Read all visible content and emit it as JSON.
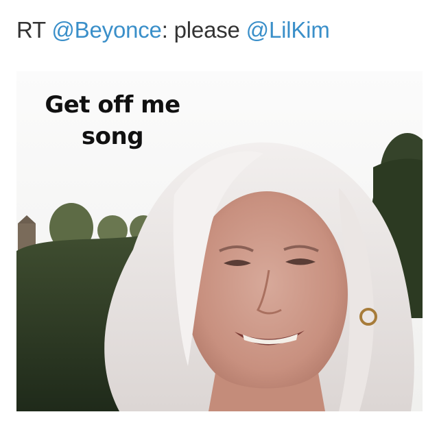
{
  "tweet": {
    "prefix": "RT",
    "mention_1": "@Beyonce",
    "middle": ": please",
    "mention_2": "@LilKim"
  },
  "image": {
    "caption_line_1": "Get off me",
    "caption_line_2": "song"
  },
  "colors": {
    "text": "#333333",
    "mention": "#3a8fc9"
  }
}
